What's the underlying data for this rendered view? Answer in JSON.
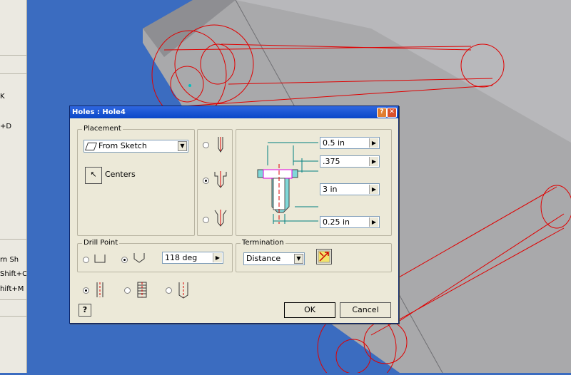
{
  "left_panel": {
    "items": [
      {
        "label": "K"
      },
      {
        "label": "+D"
      },
      {
        "label": "rn   Sh"
      },
      {
        "label": "Shift+C"
      },
      {
        "label": "hift+M"
      }
    ]
  },
  "dialog": {
    "title": "Holes : Hole4",
    "placement": {
      "group_label": "Placement",
      "selected": "From Sketch",
      "centers_label": "Centers"
    },
    "dimensions": {
      "counterbore_diameter": "0.5 in",
      "counterbore_depth": ".375",
      "hole_depth": "3 in",
      "hole_diameter": "0.25 in"
    },
    "drill_point": {
      "group_label": "Drill Point",
      "angle": "118 deg"
    },
    "termination": {
      "group_label": "Termination",
      "selected": "Distance"
    },
    "buttons": {
      "ok": "OK",
      "cancel": "Cancel",
      "help": "?"
    }
  }
}
